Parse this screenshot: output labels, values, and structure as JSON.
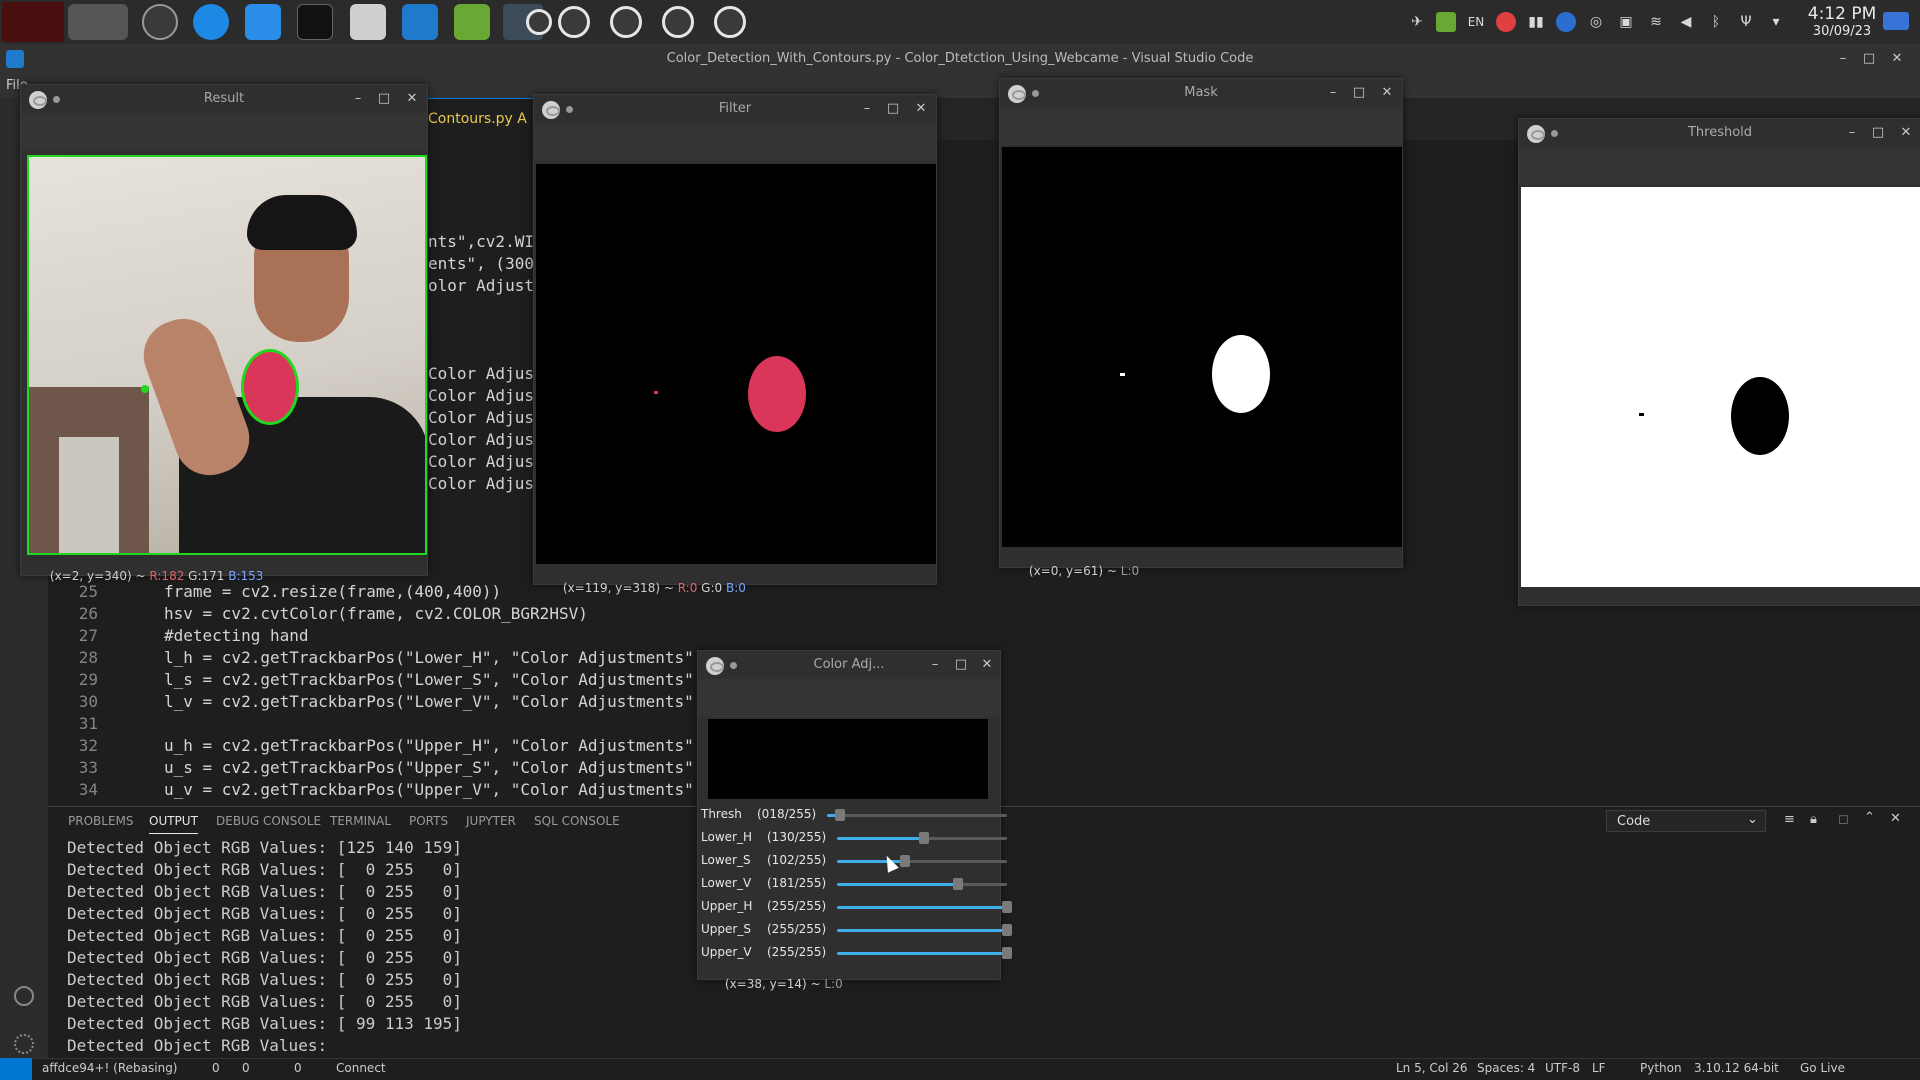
{
  "taskbar": {
    "clock_time": "4:12 PM",
    "clock_date": "30/09/23",
    "lang": "EN",
    "app_icons": [
      "app-menu-icon",
      "apps-grid-icon",
      "settings-icon",
      "app-store-icon",
      "finder-icon",
      "terminal-icon",
      "clipboard-icon",
      "vscode-icon",
      "android-icon",
      "opencv-window-icon",
      "opencv-window-icon",
      "opencv-window-icon",
      "opencv-window-icon",
      "opencv-window-icon"
    ]
  },
  "vscode": {
    "title": "Color_Detection_With_Contours.py - Color_Dtetction_Using_Webcame - Visual Studio Code",
    "menu": "File",
    "active_tab": "Contours.py A",
    "partial_lines": [
      "nts\",cv2.WI",
      "ents\", (300",
      "olor Adjust",
      "Color Adjus",
      "Color Adjus",
      "Color Adjus",
      "Color Adjus",
      "Color Adjus",
      "Color Adjus"
    ],
    "code_lines": [
      {
        "n": "25",
        "text": "frame = cv2.resize(frame,(400,400))"
      },
      {
        "n": "26",
        "text": "hsv = cv2.cvtColor(frame, cv2.COLOR_BGR2HSV)"
      },
      {
        "n": "27",
        "text": "#detecting hand"
      },
      {
        "n": "28",
        "text": "l_h = cv2.getTrackbarPos(\"Lower_H\", \"Color Adjustments\""
      },
      {
        "n": "29",
        "text": "l_s = cv2.getTrackbarPos(\"Lower_S\", \"Color Adjustments\""
      },
      {
        "n": "30",
        "text": "l_v = cv2.getTrackbarPos(\"Lower_V\", \"Color Adjustments\""
      },
      {
        "n": "31",
        "text": ""
      },
      {
        "n": "32",
        "text": "u_h = cv2.getTrackbarPos(\"Upper_H\", \"Color Adjustments\""
      },
      {
        "n": "33",
        "text": "u_s = cv2.getTrackbarPos(\"Upper_S\", \"Color Adjustments\""
      },
      {
        "n": "34",
        "text": "u_v = cv2.getTrackbarPos(\"Upper_V\", \"Color Adjustments\""
      }
    ]
  },
  "panel": {
    "tabs": [
      "PROBLEMS",
      "OUTPUT",
      "DEBUG CONSOLE",
      "TERMINAL",
      "PORTS",
      "JUPYTER",
      "SQL CONSOLE"
    ],
    "active_tab": "OUTPUT",
    "output_select": "Code",
    "output_lines": [
      "Detected Object RGB Values: [125 140 159]",
      "Detected Object RGB Values: [  0 255   0]",
      "Detected Object RGB Values: [  0 255   0]",
      "Detected Object RGB Values: [  0 255   0]",
      "Detected Object RGB Values: [  0 255   0]",
      "Detected Object RGB Values: [  0 255   0]",
      "Detected Object RGB Values: [  0 255   0]",
      "Detected Object RGB Values: [  0 255   0]",
      "Detected Object RGB Values: [ 99 113 195]",
      "Detected Object RGB Values:"
    ]
  },
  "statusbar": {
    "branch": "affdce94+! (Rebasing)",
    "errors": "0",
    "warnings": "0",
    "ports": "0",
    "connect": "Connect",
    "position": "Ln 5, Col 26",
    "spaces": "Spaces: 4",
    "encoding": "UTF-8",
    "eol": "LF",
    "language": "Python",
    "interpreter": "3.10.12 64-bit",
    "golive": "Go Live"
  },
  "windows": {
    "result": {
      "title": "Result",
      "pos": "(x=2, y=340) ~ ",
      "r": "R:182",
      "g": "G:171",
      "b": "B:153"
    },
    "filter": {
      "title": "Filter",
      "pos": "(x=119, y=318) ~ ",
      "r": "R:0",
      "g": "G:0",
      "b": "B:0"
    },
    "mask": {
      "title": "Mask",
      "pos": "(x=0, y=61) ~ ",
      "l": "L:0"
    },
    "threshold": {
      "title": "Threshold"
    },
    "coloradj": {
      "title": "Color Adj...",
      "pos": "(x=38, y=14) ~ ",
      "l": "L:0"
    }
  },
  "trackbars": [
    {
      "name": "Thresh",
      "value": "(018/255)",
      "level": 0.07
    },
    {
      "name": "Lower_H",
      "value": "(130/255)",
      "level": 0.51
    },
    {
      "name": "Lower_S",
      "value": "(102/255)",
      "level": 0.4
    },
    {
      "name": "Lower_V",
      "value": "(181/255)",
      "level": 0.71
    },
    {
      "name": "Upper_H",
      "value": "(255/255)",
      "level": 1.0
    },
    {
      "name": "Upper_S",
      "value": "(255/255)",
      "level": 1.0
    },
    {
      "name": "Upper_V",
      "value": "(255/255)",
      "level": 1.0
    }
  ],
  "colors": {
    "accent": "#0078d4",
    "slider": "#3daee9",
    "ball": "#d9365a",
    "contour": "#22d81e"
  }
}
